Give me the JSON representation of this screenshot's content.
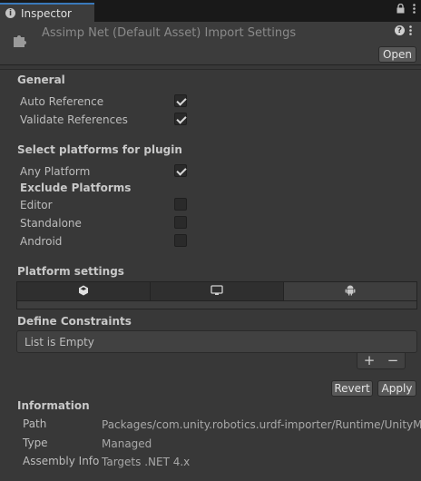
{
  "tab": {
    "label": "Inspector"
  },
  "header": {
    "title": "Assimp Net (Default Asset) Import Settings",
    "open_label": "Open"
  },
  "general": {
    "title": "General",
    "auto_reference": {
      "label": "Auto Reference",
      "checked": true
    },
    "validate_references": {
      "label": "Validate References",
      "checked": true
    }
  },
  "platforms": {
    "title": "Select platforms for plugin",
    "any_platform": {
      "label": "Any Platform",
      "checked": true
    },
    "exclude_title": "Exclude Platforms",
    "exclude": [
      {
        "label": "Editor",
        "checked": false
      },
      {
        "label": "Standalone",
        "checked": false
      },
      {
        "label": "Android",
        "checked": false
      }
    ]
  },
  "platform_settings": {
    "title": "Platform settings",
    "tabs": [
      {
        "icon": "unity-icon",
        "active": false
      },
      {
        "icon": "monitor-icon",
        "active": false
      },
      {
        "icon": "android-icon",
        "active": true
      }
    ]
  },
  "define_constraints": {
    "title": "Define Constraints",
    "empty_text": "List is Empty",
    "add_label": "+",
    "remove_label": "−"
  },
  "actions": {
    "revert_label": "Revert",
    "apply_label": "Apply"
  },
  "information": {
    "title": "Information",
    "rows": [
      {
        "label": "Path",
        "value": "Packages/com.unity.robotics.urdf-importer/Runtime/UnityMeshImporter/Plugins/AssimpNet/AssimpNet.dll"
      },
      {
        "label": "Type",
        "value": "Managed"
      },
      {
        "label": "Assembly Info",
        "value": "Targets .NET 4.x"
      }
    ]
  },
  "colors": {
    "accent": "#3a79bb",
    "background": "#383838",
    "tabbar": "#191919"
  }
}
